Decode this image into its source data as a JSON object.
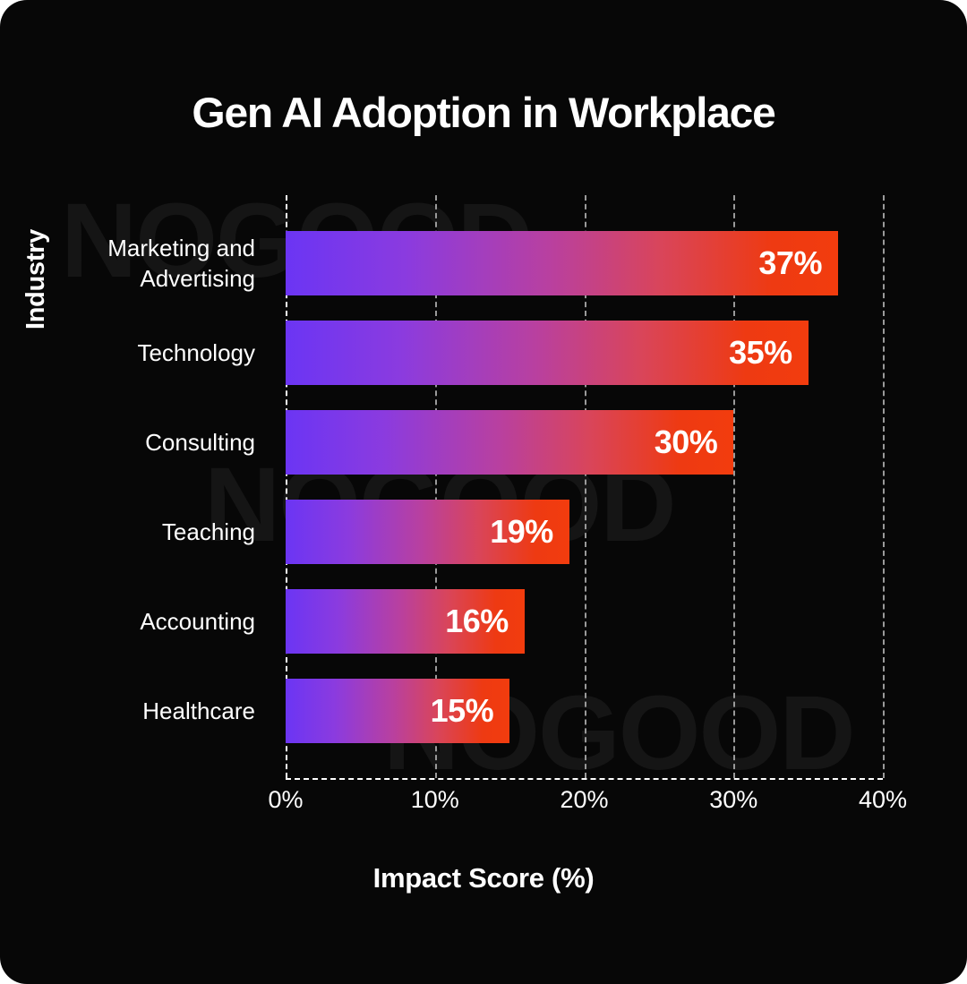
{
  "chart_data": {
    "type": "bar",
    "orientation": "horizontal",
    "title": "Gen AI Adoption in Workplace",
    "xlabel": "Impact Score (%)",
    "ylabel": "Industry",
    "categories": [
      "Marketing and\nAdvertising",
      "Technology",
      "Consulting",
      "Teaching",
      "Accounting",
      "Healthcare"
    ],
    "values": [
      37,
      35,
      30,
      19,
      16,
      15
    ],
    "value_labels": [
      "37%",
      "35%",
      "30%",
      "19%",
      "16%",
      "15%"
    ],
    "xlim": [
      0,
      40
    ],
    "xticks": [
      0,
      10,
      20,
      30,
      40
    ],
    "xtick_labels": [
      "0%",
      "10%",
      "20%",
      "30%",
      "40%"
    ],
    "grid": true,
    "grid_style": "dashed-vertical",
    "legend": null,
    "background_color": "#070707",
    "text_color": "#ffffff",
    "grid_color": "#9a9a9a",
    "bar_gradient_start": "#6b35f4",
    "bar_gradient_end": "#f23c0e"
  },
  "watermark": {
    "text": "NOGOOD",
    "color": "#151515",
    "instances": 3
  }
}
